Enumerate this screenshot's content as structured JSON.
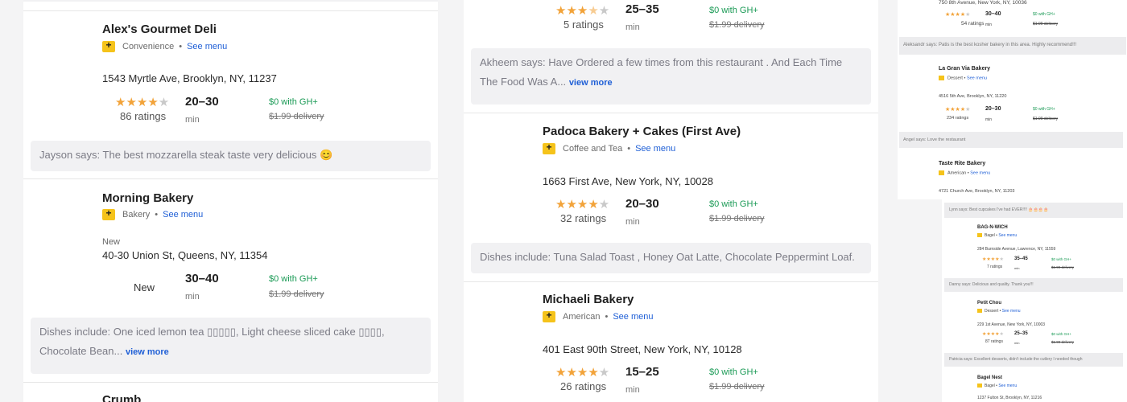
{
  "left": {
    "cards": [
      {
        "name": "Alex's Gourmet Deli",
        "category": "Convenience",
        "see_menu": "See menu",
        "address": "1543 Myrtle Ave, Brooklyn, NY, 11237",
        "rating": 4,
        "ratings_text": "86 ratings",
        "eta": "20–30",
        "eta_unit": "min",
        "promo": "$0 with GH+",
        "delivery": "$1.99 delivery",
        "review": "Jayson says: The best mozzarella steak taste very delicious 😊"
      },
      {
        "name": "Morning Bakery",
        "category": "Bakery",
        "see_menu": "See menu",
        "new_tag": "New",
        "address": "40-30 Union St, Queens, NY, 11354",
        "rating_label": "New",
        "eta": "30–40",
        "eta_unit": "min",
        "promo": "$0 with GH+",
        "delivery": "$1.99 delivery",
        "review_line1": "Dishes include: One iced lemon tea ▯▯▯▯▯, Light cheese sliced cake ▯▯▯▯,",
        "review_line2": "Chocolate Bean...",
        "view_more": "view more"
      },
      {
        "name": "Crumb"
      }
    ]
  },
  "middle": {
    "top": {
      "rating": 3.5,
      "ratings_text": "5 ratings",
      "eta": "25–35",
      "eta_unit": "min",
      "promo": "$0 with GH+",
      "delivery": "$1.99 delivery",
      "review_line1": "Akheem says: Have Ordered a few times from this restaurant . And Each Time",
      "review_line2": "The Food Was A...",
      "view_more": "view more"
    },
    "cards": [
      {
        "name": "Padoca Bakery + Cakes (First Ave)",
        "category": "Coffee and Tea",
        "see_menu": "See menu",
        "address": "1663 First Ave, New York, NY, 10028",
        "rating": 4,
        "ratings_text": "32 ratings",
        "eta": "20–30",
        "eta_unit": "min",
        "promo": "$0 with GH+",
        "delivery": "$1.99 delivery",
        "review": "Dishes include: Tuna Salad Toast , Honey Oat Latte, Chocolate Peppermint Loaf."
      },
      {
        "name": "Michaeli Bakery",
        "category": "American",
        "see_menu": "See menu",
        "address": "401 East 90th Street, New York, NY, 10128",
        "rating": 4,
        "ratings_text": "26 ratings",
        "eta": "15–25",
        "eta_unit": "min",
        "promo": "$0 with GH+",
        "delivery": "$1.99 delivery"
      }
    ]
  },
  "right": {
    "top_address": "750 8th Avenue, New York, NY, 10036",
    "top_ratings": "54 ratings",
    "top_eta": "30–40",
    "top_review": "Aleksandr says: Patis is the best kosher bakery in this area. Highly recommend!!!",
    "items": [
      {
        "name": "La Gran Via Bakery",
        "category": "Dessert",
        "address": "4516 5th Ave, Brooklyn, NY, 11220",
        "ratings": "234 ratings",
        "eta": "20–30",
        "review": "Angel says: Love the restaurant"
      },
      {
        "name": "Taste Rite Bakery",
        "category": "American",
        "address": "4721 Church Ave, Brooklyn, NY, 11203",
        "review": "Lynn says: Best cupcakes I've had EVER!!!! 🎂🎂🎂🎂"
      },
      {
        "name": "BAG-N-WICH",
        "category": "Bagel",
        "address": "284 Burnside Avenue, Lawrence, NY, 11559",
        "ratings": "7 ratings",
        "eta": "35–45",
        "review": "Danny says: Delicious and quality. Thank you!!!"
      },
      {
        "name": "Petit Chou",
        "category": "Dessert",
        "address": "229 1st Avenue, New York, NY, 10003",
        "ratings": "87 ratings",
        "eta": "25–35",
        "review": "Patricia says: Excellent desserts, didn't include the cutlery I needed though"
      },
      {
        "name": "Bagel Nest",
        "category": "Bagel",
        "address": "1237 Fulton St, Brooklyn, NY, 11216"
      }
    ],
    "see_menu": "See menu",
    "eta_unit": "min",
    "promo": "$0 with GH+",
    "delivery": "$1.99 delivery"
  }
}
